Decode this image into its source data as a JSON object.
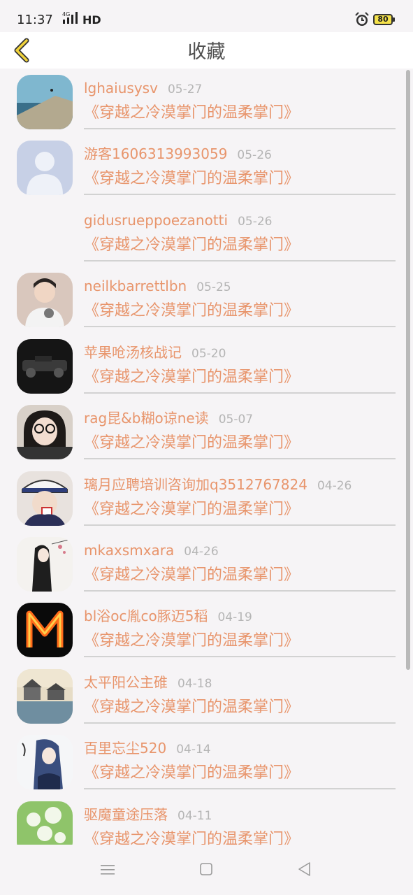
{
  "status_bar": {
    "time": "11:37",
    "network": "4G",
    "hd": "HD",
    "battery": "80",
    "icons": [
      "alarm-icon",
      "signal-icon",
      "battery-icon"
    ]
  },
  "header": {
    "title": "收藏",
    "back_icon": "chevron-left-icon",
    "back_color": "#e6c52a"
  },
  "favorites": [
    {
      "user": "lghaiusysv",
      "date": "05-27",
      "book": "《穿越之冷漠掌门的温柔掌门》"
    },
    {
      "user": "游客1606313993059",
      "date": "05-26",
      "book": "《穿越之冷漠掌门的温柔掌门》"
    },
    {
      "user": "gidusrueppoezanotti",
      "date": "05-26",
      "book": "《穿越之冷漠掌门的温柔掌门》"
    },
    {
      "user": "neilkbarrettlbn",
      "date": "05-25",
      "book": "《穿越之冷漠掌门的温柔掌门》"
    },
    {
      "user": "苹果呛汤核战记",
      "date": "05-20",
      "book": "《穿越之冷漠掌门的温柔掌门》"
    },
    {
      "user": "rag昆&b糊o谅ne读",
      "date": "05-07",
      "book": "《穿越之冷漠掌门的温柔掌门》"
    },
    {
      "user": "璃月应聘培训咨询加q3512767824",
      "date": "04-26",
      "book": "《穿越之冷漠掌门的温柔掌门》"
    },
    {
      "user": "mkaxsmxara",
      "date": "04-26",
      "book": "《穿越之冷漠掌门的温柔掌门》"
    },
    {
      "user": "bl浴oc胤co豚迈5稻",
      "date": "04-19",
      "book": "《穿越之冷漠掌门的温柔掌门》"
    },
    {
      "user": "太平阳公主碓",
      "date": "04-18",
      "book": "《穿越之冷漠掌门的温柔掌门》"
    },
    {
      "user": "百里忘尘520",
      "date": "04-14",
      "book": "《穿越之冷漠掌门的温柔掌门》"
    },
    {
      "user": "驱魔童途压落",
      "date": "04-11",
      "book": "《穿越之冷漠掌门的温柔掌门》"
    }
  ],
  "colors": {
    "accent": "#e8956c",
    "date": "#b5b5b5",
    "background": "#f6f4f6"
  },
  "nav": {
    "icons": [
      "menu-icon",
      "home-icon",
      "back-icon"
    ]
  }
}
